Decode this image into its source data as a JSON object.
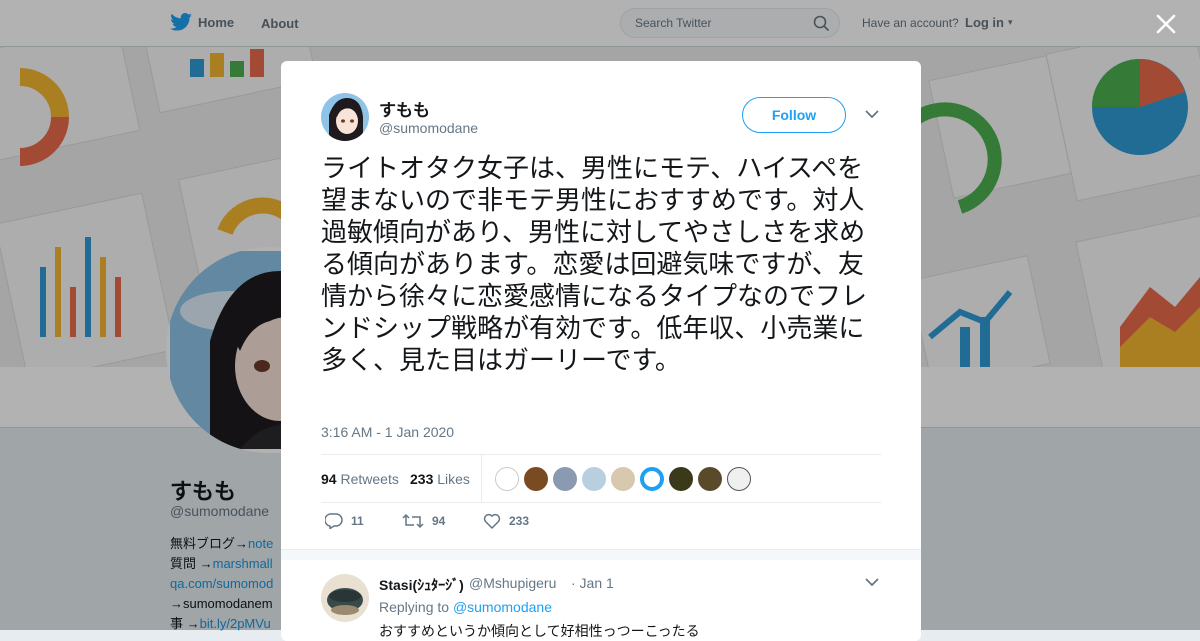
{
  "nav": {
    "home_label": "Home",
    "about_label": "About",
    "search_placeholder": "Search Twitter",
    "have_account": "Have an account?",
    "login_label": "Log in"
  },
  "profile": {
    "name": "すもも",
    "handle": "@sumomodane",
    "bio_lines": [
      {
        "text": "無料ブログ→",
        "link": "note"
      },
      {
        "text": "質問 →",
        "link": "marshmall"
      },
      {
        "text": "",
        "link": "qa.com/sumomod"
      },
      {
        "text": "→sumomodanem",
        "link": ""
      },
      {
        "text": "事 →",
        "link": "bit.ly/2pMVu"
      }
    ]
  },
  "tweet": {
    "name": "すもも",
    "handle": "@sumomodane",
    "follow_label": "Follow",
    "text": "ライトオタク女子は、男性にモテ、ハイスペを望まないので非モテ男性におすすめです。対人過敏傾向があり、男性に対してやさしさを求める傾向があります。恋愛は回避気味ですが、友情から徐々に恋愛感情になるタイプなのでフレンドシップ戦略が有効です。低年収、小売業に多く、見た目はガーリーです。",
    "timestamp": "3:16 AM - 1 Jan 2020",
    "retweets_count": "94",
    "retweets_label": "Retweets",
    "likes_count": "233",
    "likes_label": "Likes",
    "actions": {
      "replies": "11",
      "retweets": "94",
      "likes": "233"
    }
  },
  "reply": {
    "name": "Stasi(ｼｭﾀｰｼﾞ)",
    "handle": "@Mshupigeru",
    "date": "· Jan 1",
    "replying_prefix": "Replying to",
    "replying_to": "@sumomodane",
    "text": "おすすめというか傾向として好相性っつーこったる"
  },
  "colors": {
    "accent": "#1da1f2",
    "twitter_blue": "#1da1f2",
    "muted": "#657786"
  },
  "icons": [
    "twitter-bird-icon",
    "search-icon",
    "close-icon",
    "chevron-down-icon",
    "reply-icon",
    "retweet-icon",
    "heart-icon"
  ]
}
